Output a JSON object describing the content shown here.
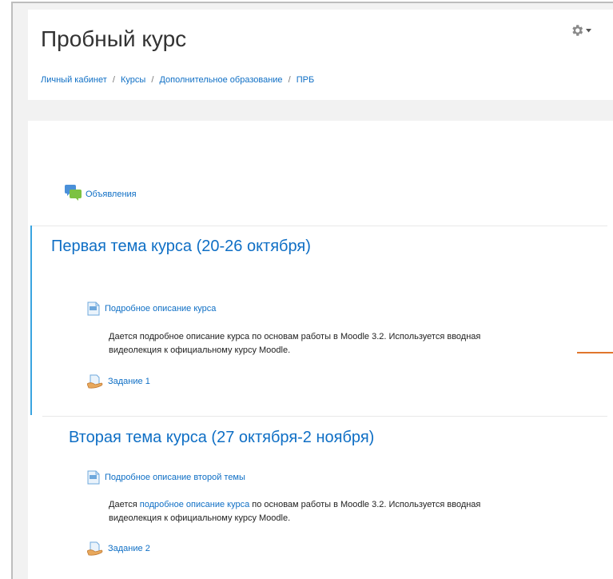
{
  "header": {
    "title": "Пробный курс",
    "breadcrumb": [
      "Личный кабинет",
      "Курсы",
      "Дополнительное образование",
      "ПРБ"
    ],
    "breadcrumb_separator": "/",
    "settings_icon": "gear-icon"
  },
  "announcements": {
    "label": "Объявления",
    "icon": "forum-icon"
  },
  "sections": [
    {
      "title": "Первая тема курса (20-26 октября)",
      "activities": [
        {
          "label": "Подробное описание курса",
          "icon": "page-icon",
          "description_part1": "Дается подробное описание курса по основам работы в Moodle 3.2. Используется вводная",
          "description_part2": "видеолекция к официальному курсу Moodle."
        },
        {
          "label": "Задание 1",
          "icon": "assignment-icon"
        }
      ]
    },
    {
      "title": "Вторая тема курса (27 октября-2 ноября)",
      "activities": [
        {
          "label": "Подробное описание второй темы",
          "icon": "page-icon",
          "description_prefix": "Дается",
          "description_link": "подробное описание курса",
          "description_suffix": "по основам работы в Moodle 3.2. Используется вводная",
          "description_line2": "видеолекция к официальному курсу Moodle."
        },
        {
          "label": "Задание 2",
          "icon": "assignment-icon"
        }
      ]
    }
  ],
  "colors": {
    "link": "#0f6fc5",
    "accent": "#3aa4e0",
    "orange": "#e0762c",
    "background": "#f2f2f2"
  }
}
